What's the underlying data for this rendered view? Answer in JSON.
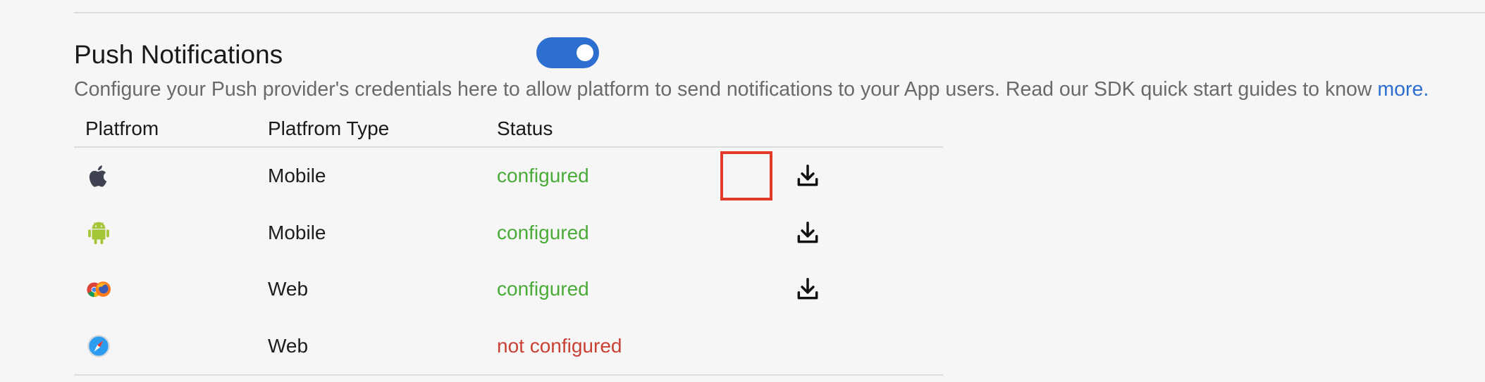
{
  "section": {
    "title": "Push Notifications",
    "toggle_on": true,
    "toggle_color": "#2d6ed1",
    "description": "Configure your Push provider's credentials here to allow platform to send notifications to your App users. Read our SDK quick start guides to know ",
    "more_link": "more."
  },
  "colors": {
    "configured": "#4bab38",
    "not_configured": "#c94035",
    "link": "#2d6ed1",
    "highlight": "#e23b2a"
  },
  "table": {
    "headers": [
      "Platfrom",
      "Platfrom Type",
      "Status"
    ],
    "rows": [
      {
        "icon": "apple-icon",
        "type": "Mobile",
        "status": "configured",
        "download": true,
        "highlighted": true
      },
      {
        "icon": "android-icon",
        "type": "Mobile",
        "status": "configured",
        "download": true,
        "highlighted": false
      },
      {
        "icon": "chrome-firefox-icon",
        "type": "Web",
        "status": "configured",
        "download": true,
        "highlighted": false
      },
      {
        "icon": "safari-icon",
        "type": "Web",
        "status": "not configured",
        "download": false,
        "highlighted": false
      }
    ]
  }
}
